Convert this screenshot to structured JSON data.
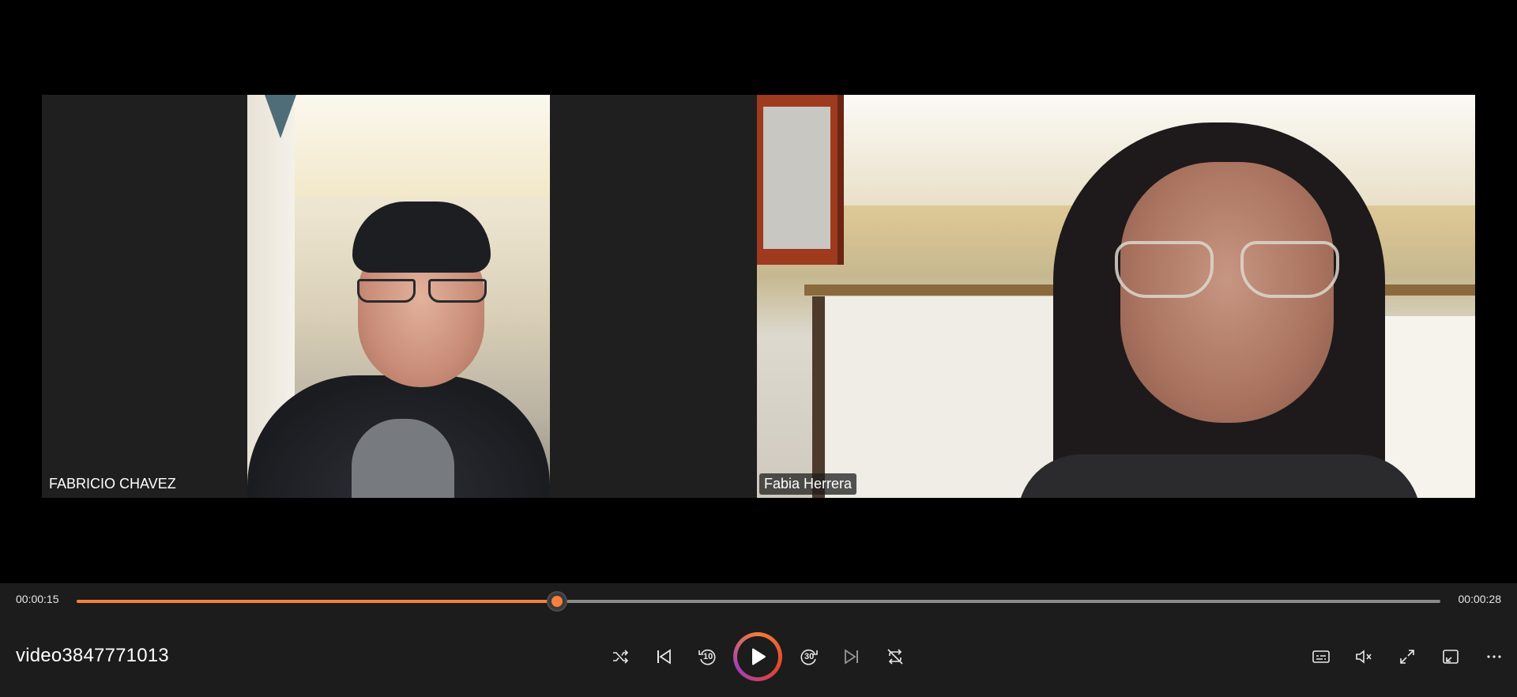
{
  "participants": [
    {
      "name": "FABRICIO CHAVEZ"
    },
    {
      "name": "Fabia Herrera"
    }
  ],
  "player": {
    "title": "video3847771013",
    "current_time": "00:00:15",
    "duration": "00:00:28",
    "progress_fraction": 0.352,
    "accent_color": "#f7803c",
    "skip_back_seconds": "10",
    "skip_forward_seconds": "30"
  },
  "icons": {
    "shuffle": "shuffle-icon",
    "previous": "previous-track-icon",
    "skip_back": "skip-back-10-icon",
    "play": "play-icon",
    "skip_forward": "skip-forward-30-icon",
    "next": "next-track-icon",
    "repeat": "repeat-off-icon",
    "captions": "captions-icon",
    "volume": "volume-muted-icon",
    "fullscreen": "fullscreen-icon",
    "miniplayer": "miniplayer-icon",
    "more": "more-options-icon"
  }
}
